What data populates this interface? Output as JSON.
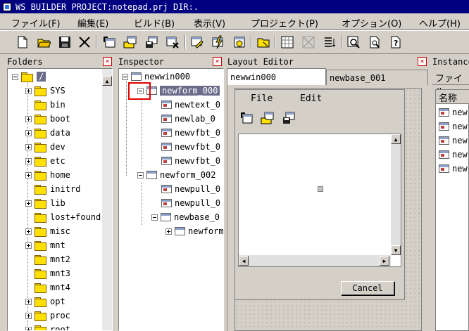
{
  "title": "WS BUILDER PROJECT:notepad.prj DIR:.",
  "menu": [
    {
      "label": "ファイル(F)"
    },
    {
      "label": "編集(E)"
    },
    {
      "label": "ビルド(B)"
    },
    {
      "label": "表示(V)"
    },
    {
      "label": "プロジェクト(P)"
    },
    {
      "label": "オプション(O)"
    },
    {
      "label": "ヘルプ(H)"
    }
  ],
  "toolbar_icons": [
    "new-file-icon",
    "open-folder-icon",
    "save-icon",
    "cut-icon",
    "new-window-icon",
    "open-window-icon",
    "save-window-icon",
    "close-window-icon",
    "edit-icon",
    "build-icon",
    "run-icon",
    "folder-icon",
    "grid-icon",
    "align-icon",
    "list-icon",
    "search-icon",
    "preview-icon",
    "help-icon"
  ],
  "panels": {
    "folders": "Folders",
    "inspector": "Inspector",
    "layout_editor": "Layout Editor",
    "instance": "Instance"
  },
  "folders": [
    "/",
    "SYS",
    "bin",
    "boot",
    "data",
    "dev",
    "etc",
    "home",
    "initrd",
    "lib",
    "lost+found",
    "misc",
    "mnt",
    "mnt2",
    "mnt3",
    "mnt4",
    "opt",
    "proc",
    "root"
  ],
  "inspector": [
    {
      "label": "newwin000"
    },
    {
      "label": "newform_000"
    },
    {
      "label": "newtext_0"
    },
    {
      "label": "newlab_0"
    },
    {
      "label": "newvfbt_0"
    },
    {
      "label": "newvfbt_0"
    },
    {
      "label": "newvfbt_0"
    },
    {
      "label": "newform_002"
    },
    {
      "label": "newpull_0"
    },
    {
      "label": "newpull_0"
    },
    {
      "label": "newbase_0"
    },
    {
      "label": "newform"
    }
  ],
  "layout_tabs": [
    "newwin000",
    "newbase_001"
  ],
  "layout_menu": {
    "file": "File",
    "edit": "Edit"
  },
  "cancel_label": "Cancel",
  "instance": {
    "tab": "ファイル",
    "col": "名称",
    "items": [
      "new",
      "new",
      "new",
      "new",
      "new"
    ]
  }
}
